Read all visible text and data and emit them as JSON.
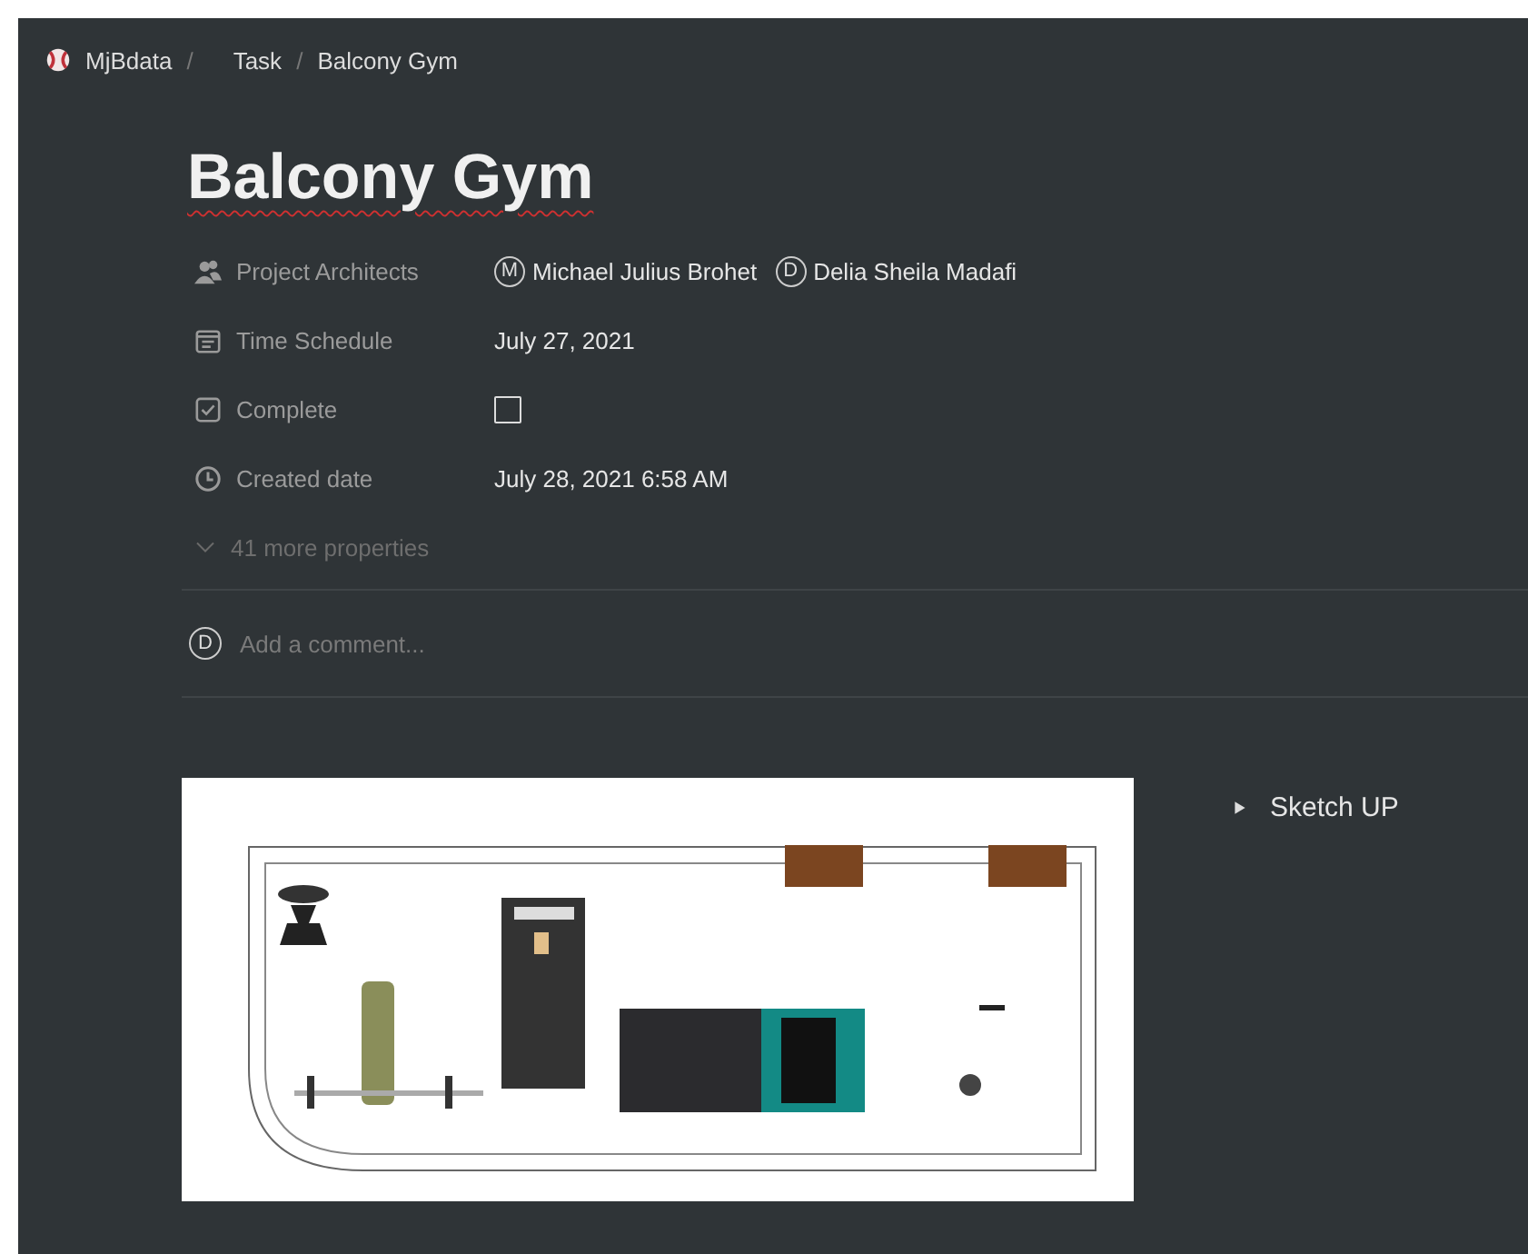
{
  "breadcrumb": [
    {
      "label": "MjBdata",
      "kind": "workspace"
    },
    {
      "label": "Task",
      "kind": "page"
    },
    {
      "label": "Balcony Gym",
      "kind": "page"
    }
  ],
  "separator": "/",
  "title": "Balcony Gym",
  "properties": [
    {
      "kind": "person",
      "label": "Project Architects",
      "people": [
        {
          "initial": "M",
          "name": "Michael Julius Brohet"
        },
        {
          "initial": "D",
          "name": "Delia Sheila Madafi"
        }
      ]
    },
    {
      "kind": "date",
      "label": "Time Schedule",
      "value": "July 27, 2021"
    },
    {
      "kind": "checkbox",
      "label": "Complete",
      "checked": false
    },
    {
      "kind": "created",
      "label": "Created date",
      "value": "July 28, 2021 6:58 AM"
    }
  ],
  "more_properties": "41 more properties",
  "comment": {
    "initial": "D",
    "placeholder": "Add a comment..."
  },
  "toggle": {
    "label": "Sketch UP",
    "expanded": false
  }
}
